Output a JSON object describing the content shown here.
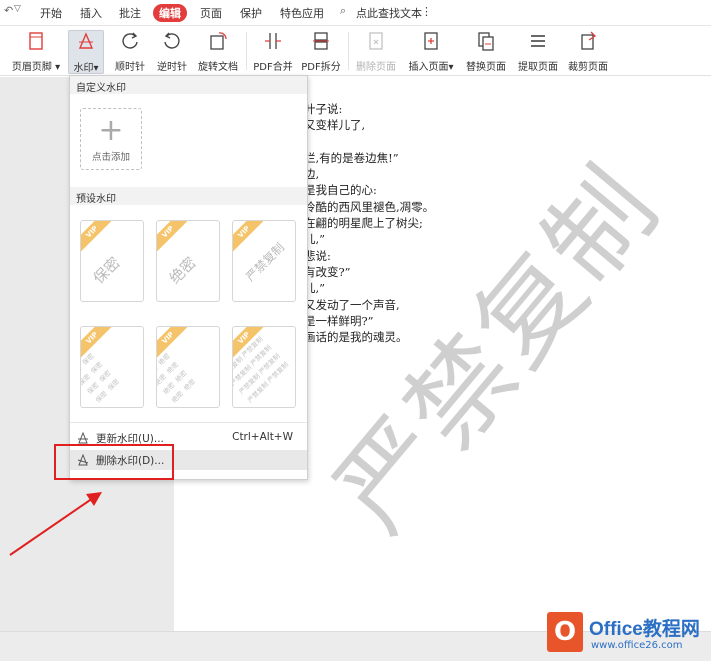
{
  "menubar": {
    "items": [
      {
        "label": "开始"
      },
      {
        "label": "插入"
      },
      {
        "label": "批注"
      },
      {
        "label": "编辑"
      },
      {
        "label": "页面"
      },
      {
        "label": "保护"
      },
      {
        "label": "特色应用"
      }
    ],
    "active_item": "编辑",
    "search_label": "点此查找文本",
    "more": "⋮"
  },
  "toolbar": {
    "header_footer": "页眉页脚",
    "watermark": "水印",
    "rotate_cw": "顺时针",
    "rotate_ccw": "逆时针",
    "rotate_doc": "旋转文档",
    "pdf_merge": "PDF合并",
    "pdf_split": "PDF拆分",
    "delete_page": "删除页面",
    "insert_page": "插入页面",
    "replace_page": "替换页面",
    "extract_page": "提取页面",
    "crop_page": "裁剪页面"
  },
  "watermark_menu": {
    "custom_section": "自定义水印",
    "add_label": "点击添加",
    "preset_section": "预设水印",
    "vip_badge": "VIP",
    "presets_single": [
      "保密",
      "绝密",
      "严禁复制"
    ],
    "presets_tiled": [
      "保密",
      "绝密",
      "严禁复制"
    ],
    "update_label": "更新水印(U)...",
    "update_shortcut": "Ctrl+Alt+W",
    "delete_label": "删除水印(D)..."
  },
  "document": {
    "lines": [
      "叶子说:",
      "又变样儿了,",
      "",
      "烂,有的是卷边焦!”",
      "边,",
      "是我自己的心:",
      "冷酷的西风里褪色,凋零。",
      "在翩的明星爬上了树尖;",
      "儿,”",
      "悲说:",
      "有改变?”",
      "儿,”",
      "又发动了一个声音,",
      "是一样鲜明?”",
      "画话的是我的魂灵。"
    ],
    "watermark_text": "严禁复制"
  },
  "logo": {
    "mark": "O",
    "title": "Office教程网",
    "url": "www.office26.com"
  },
  "colors": {
    "accent": "#e23c3c",
    "highlight_box": "#e02020",
    "logo_blue": "#2a6fc4",
    "logo_orange": "#e8552a"
  }
}
